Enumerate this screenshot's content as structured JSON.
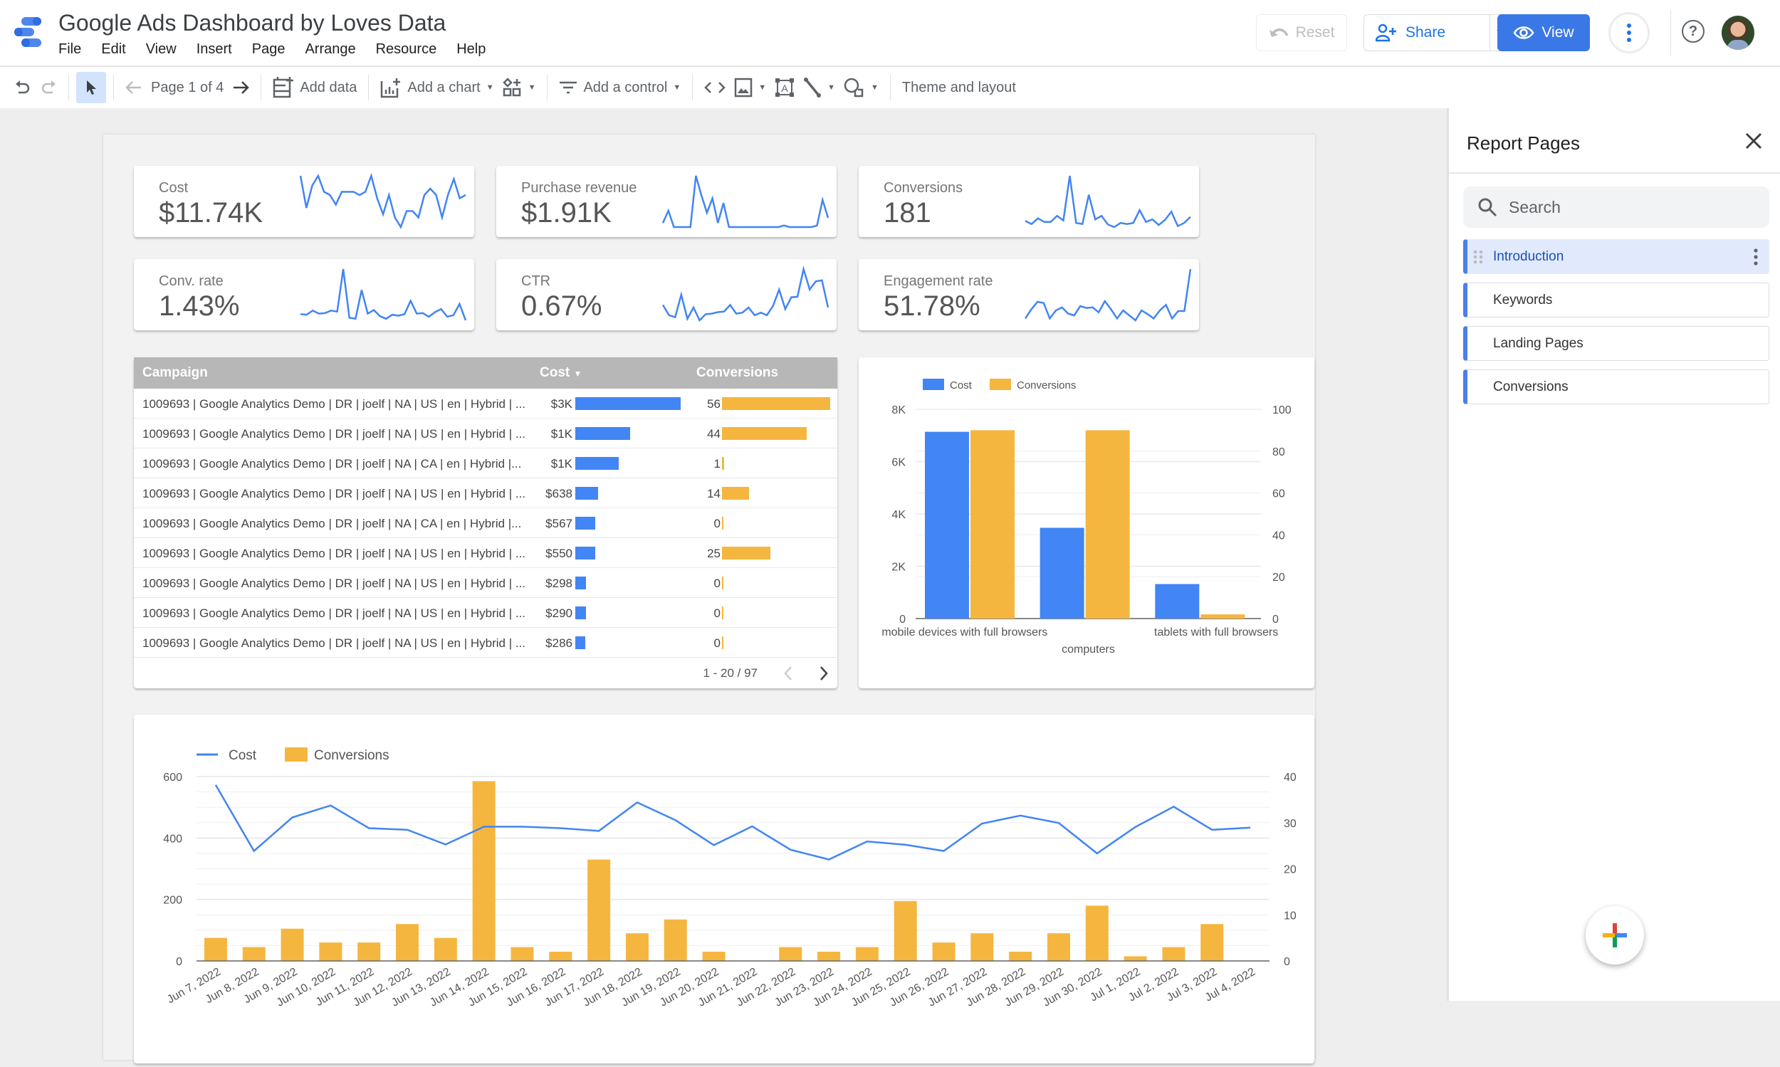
{
  "app": {
    "title": "Google Ads Dashboard by Loves Data",
    "menu": [
      "File",
      "Edit",
      "View",
      "Insert",
      "Page",
      "Arrange",
      "Resource",
      "Help"
    ],
    "buttons": {
      "reset": "Reset",
      "share": "Share",
      "view": "View"
    }
  },
  "toolbar": {
    "page_indicator": "Page 1 of 4",
    "add_data": "Add data",
    "add_chart": "Add a chart",
    "add_control": "Add a control",
    "theme_layout": "Theme and layout"
  },
  "scorecards": [
    {
      "label": "Cost",
      "value": "$11.74K",
      "spark": [
        58,
        48,
        55,
        58,
        53,
        52,
        49,
        53,
        53,
        53,
        52,
        53,
        58,
        51,
        46,
        52,
        45,
        42,
        47,
        47,
        45,
        52,
        54,
        52,
        45,
        52,
        57,
        51,
        52
      ]
    },
    {
      "label": "Purchase revenue",
      "value": "$1.91K",
      "spark": [
        8,
        32,
        0,
        0,
        0,
        0,
        100,
        62,
        28,
        56,
        8,
        47,
        0,
        0,
        0,
        0,
        0,
        0,
        0,
        0,
        0,
        0,
        3,
        0,
        0,
        0,
        0,
        0,
        3,
        53,
        18
      ]
    },
    {
      "label": "Conversions",
      "value": "181",
      "spark": [
        12,
        6,
        17,
        10,
        10,
        22,
        13,
        100,
        8,
        6,
        63,
        15,
        22,
        5,
        0,
        8,
        6,
        8,
        33,
        10,
        15,
        4,
        14,
        30,
        2,
        8,
        20
      ]
    },
    {
      "label": "Conv. rate",
      "value": "1.43%",
      "spark": [
        12,
        11,
        19,
        13,
        14,
        19,
        17,
        100,
        5,
        3,
        59,
        13,
        20,
        8,
        3,
        11,
        9,
        12,
        38,
        13,
        14,
        7,
        16,
        22,
        7,
        10,
        32,
        0
      ]
    },
    {
      "label": "CTR",
      "value": "0.67%",
      "spark": [
        30,
        10,
        6,
        50,
        3,
        25,
        0,
        12,
        13,
        16,
        17,
        30,
        13,
        15,
        25,
        10,
        15,
        10,
        28,
        60,
        22,
        45,
        46,
        100,
        60,
        76,
        78,
        25
      ]
    },
    {
      "label": "Engagement rate",
      "value": "51.78%",
      "spark": [
        20,
        35,
        47,
        45,
        20,
        33,
        38,
        28,
        25,
        40,
        37,
        38,
        30,
        48,
        35,
        20,
        33,
        25,
        17,
        33,
        27,
        20,
        33,
        42,
        20,
        32,
        32,
        100
      ]
    }
  ],
  "campaign_table": {
    "headers": {
      "campaign": "Campaign",
      "cost": "Cost",
      "conversions": "Conversions"
    },
    "sort_indicator": "▼",
    "rows": [
      {
        "campaign": "1009693 | Google Analytics Demo | DR | joelf | NA | US | en | Hybrid | ...",
        "cost": "$3K",
        "cost_value": 2950,
        "conversions": "56",
        "conv_value": 56
      },
      {
        "campaign": "1009693 | Google Analytics Demo | DR | joelf | NA | US | en | Hybrid | ...",
        "cost": "$1K",
        "cost_value": 1530,
        "conversions": "44",
        "conv_value": 44
      },
      {
        "campaign": "1009693 | Google Analytics Demo | DR | joelf | NA | CA | en | Hybrid |...",
        "cost": "$1K",
        "cost_value": 1210,
        "conversions": "1",
        "conv_value": 1
      },
      {
        "campaign": "1009693 | Google Analytics Demo | DR | joelf | NA | US | en | Hybrid | ...",
        "cost": "$638",
        "cost_value": 638,
        "conversions": "14",
        "conv_value": 14
      },
      {
        "campaign": "1009693 | Google Analytics Demo | DR | joelf | NA | CA | en | Hybrid |...",
        "cost": "$567",
        "cost_value": 567,
        "conversions": "0",
        "conv_value": 0
      },
      {
        "campaign": "1009693 | Google Analytics Demo | DR | joelf | NA | US | en | Hybrid | ...",
        "cost": "$550",
        "cost_value": 550,
        "conversions": "25",
        "conv_value": 25
      },
      {
        "campaign": "1009693 | Google Analytics Demo | DR | joelf | NA | US | en | Hybrid | ...",
        "cost": "$298",
        "cost_value": 298,
        "conversions": "0",
        "conv_value": 0
      },
      {
        "campaign": "1009693 | Google Analytics Demo | DR | joelf | NA | US | en | Hybrid | ...",
        "cost": "$290",
        "cost_value": 290,
        "conversions": "0",
        "conv_value": 0
      },
      {
        "campaign": "1009693 | Google Analytics Demo | DR | joelf | NA | US | en | Hybrid | ...",
        "cost": "$286",
        "cost_value": 286,
        "conversions": "0",
        "conv_value": 0
      }
    ],
    "pagination": "1 - 20 / 97"
  },
  "sidebar": {
    "title": "Report Pages",
    "search_placeholder": "Search",
    "pages": [
      {
        "label": "Introduction",
        "active": true
      },
      {
        "label": "Keywords",
        "active": false
      },
      {
        "label": "Landing Pages",
        "active": false
      },
      {
        "label": "Conversions",
        "active": false
      }
    ]
  },
  "colors": {
    "cost": "#4285f4",
    "conversions": "#f5b63f",
    "accent": "#3b78e7"
  },
  "chart_data": [
    {
      "type": "bar",
      "title": "",
      "categories": [
        "mobile devices with full browsers",
        "computers",
        "tablets with full browsers"
      ],
      "series": [
        {
          "name": "Cost",
          "axis": "left",
          "values": [
            7140,
            3470,
            1320
          ]
        },
        {
          "name": "Conversions",
          "axis": "right",
          "values": [
            90,
            90,
            2
          ]
        }
      ],
      "left_axis": {
        "ylim": [
          0,
          8000
        ],
        "ticks": [
          "0",
          "2K",
          "4K",
          "6K",
          "8K"
        ]
      },
      "right_axis": {
        "ylim": [
          0,
          100
        ],
        "ticks": [
          "0",
          "20",
          "40",
          "60",
          "80",
          "100"
        ]
      },
      "legend": "top-left",
      "grid": true
    },
    {
      "type": "bar",
      "subtype": "combo-line-bar",
      "title": "",
      "x": [
        "Jun 7, 2022",
        "Jun 8, 2022",
        "Jun 9, 2022",
        "Jun 10, 2022",
        "Jun 11, 2022",
        "Jun 12, 2022",
        "Jun 13, 2022",
        "Jun 14, 2022",
        "Jun 15, 2022",
        "Jun 16, 2022",
        "Jun 17, 2022",
        "Jun 18, 2022",
        "Jun 19, 2022",
        "Jun 20, 2022",
        "Jun 21, 2022",
        "Jun 22, 2022",
        "Jun 23, 2022",
        "Jun 24, 2022",
        "Jun 25, 2022",
        "Jun 26, 2022",
        "Jun 27, 2022",
        "Jun 28, 2022",
        "Jun 29, 2022",
        "Jun 30, 2022",
        "Jul 1, 2022",
        "Jul 2, 2022",
        "Jul 3, 2022",
        "Jul 4, 2022"
      ],
      "series": [
        {
          "name": "Cost",
          "kind": "line",
          "axis": "left",
          "values": [
            573,
            358,
            467,
            506,
            432,
            427,
            379,
            437,
            437,
            432,
            423,
            516,
            458,
            377,
            438,
            362,
            330,
            389,
            378,
            358,
            447,
            473,
            449,
            350,
            436,
            502,
            427,
            434
          ]
        },
        {
          "name": "Conversions",
          "kind": "bar",
          "axis": "right",
          "values": [
            5,
            3,
            7,
            4,
            4,
            8,
            5,
            39,
            3,
            2,
            22,
            6,
            9,
            2,
            0,
            3,
            2,
            3,
            13,
            4,
            6,
            2,
            6,
            12,
            1,
            3,
            8,
            0
          ]
        }
      ],
      "left_axis": {
        "ylim": [
          0,
          600
        ],
        "ticks": [
          "0",
          "200",
          "400",
          "600"
        ]
      },
      "right_axis": {
        "ylim": [
          0,
          40
        ],
        "ticks": [
          "0",
          "10",
          "20",
          "30",
          "40"
        ]
      },
      "legend": "top-left",
      "grid": true
    }
  ]
}
